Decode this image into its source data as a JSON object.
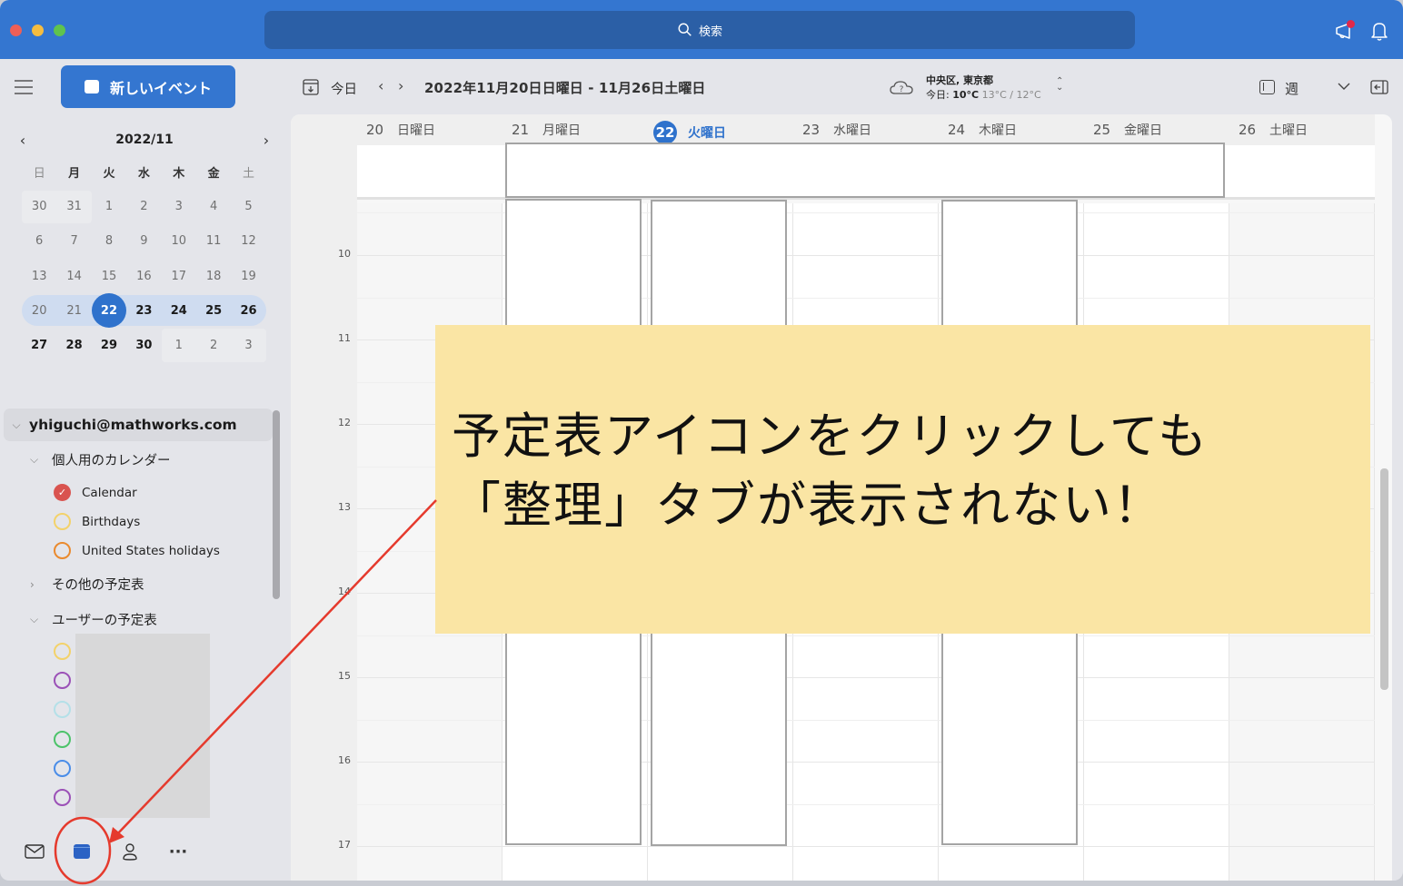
{
  "titlebar": {
    "search_label": "検索",
    "notification_dot_color": "#e0284a",
    "accent_color": "#3476d0"
  },
  "sidebar": {
    "new_event_label": "新しいイベント",
    "mini_calendar": {
      "title": "2022/11",
      "weekdays": [
        "日",
        "月",
        "火",
        "水",
        "木",
        "金",
        "土"
      ],
      "weeks": [
        [
          "30",
          "31",
          "1",
          "2",
          "3",
          "4",
          "5"
        ],
        [
          "6",
          "7",
          "8",
          "9",
          "10",
          "11",
          "12"
        ],
        [
          "13",
          "14",
          "15",
          "16",
          "17",
          "18",
          "19"
        ],
        [
          "20",
          "21",
          "22",
          "23",
          "24",
          "25",
          "26"
        ],
        [
          "27",
          "28",
          "29",
          "30",
          "1",
          "2",
          "3"
        ]
      ],
      "selected_day": "22"
    },
    "account": "yhiguchi@mathworks.com",
    "groups": {
      "personal": "個人用のカレンダー",
      "other": "その他の予定表",
      "users": "ユーザーの予定表"
    },
    "calendars": [
      {
        "label": "Calendar",
        "color": "#d9534f",
        "checked": true
      },
      {
        "label": "Birthdays",
        "color": "#f3d26a",
        "checked": false
      },
      {
        "label": "United States holidays",
        "color": "#ea8a2e",
        "checked": false
      }
    ],
    "user_calendar_colors": [
      "#f3d26a",
      "#9b51b7",
      "#b4e0e8",
      "#4cc36a",
      "#4a8de8",
      "#9b51b7"
    ],
    "bottom_nav": [
      "mail",
      "calendar",
      "people",
      "more"
    ]
  },
  "toolbar": {
    "today_label": "今日",
    "date_range": "2022年11月20日日曜日 - 11月26日土曜日",
    "weather": {
      "location": "中央区, 東京都",
      "today_prefix": "今日:",
      "current": "10°C",
      "high_low": "13°C / 12°C"
    },
    "view_label": "週"
  },
  "week": {
    "days": [
      {
        "num": "20",
        "name": "日曜日"
      },
      {
        "num": "21",
        "name": "月曜日"
      },
      {
        "num": "22",
        "name": "火曜日",
        "today": true
      },
      {
        "num": "23",
        "name": "水曜日"
      },
      {
        "num": "24",
        "name": "木曜日"
      },
      {
        "num": "25",
        "name": "金曜日"
      },
      {
        "num": "26",
        "name": "土曜日"
      }
    ],
    "hours": [
      "10",
      "11",
      "12",
      "13",
      "14",
      "15",
      "16",
      "17"
    ]
  },
  "annotation": {
    "line1": "予定表アイコンをクリックしても",
    "line2": "「整理」タブが表示されない！",
    "bg_color": "#fae5a4",
    "arrow_color": "#e53a2d"
  }
}
